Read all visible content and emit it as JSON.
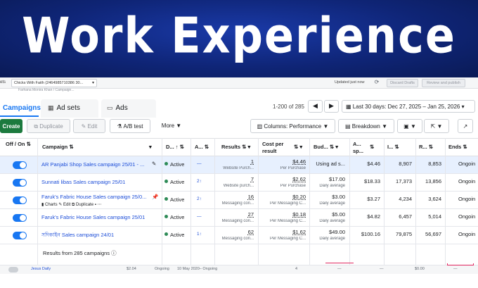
{
  "banner": {
    "title": "Work Experience"
  },
  "topbar": {
    "sets_label": "ets",
    "account": "Chicks With Faith (2464985710386 30...",
    "updated": "Updated just now",
    "discard_label": "Discard Drafts",
    "review_label": "Review and publish"
  },
  "breadcrumb": "Farhana Monira Khan / Campaign...",
  "tabs": {
    "campaigns": "Campaigns",
    "adsets": "Ad sets",
    "ads": "Ads"
  },
  "pager": {
    "range": "1-200 of 285",
    "prev": "◀",
    "next": "▶"
  },
  "date_range": "Last 30 days: Dec 27, 2025 – Jan 25, 2026",
  "toolbar": {
    "create": "Create",
    "duplicate": "Duplicate",
    "edit": "Edit",
    "ab_test": "A/B test",
    "more": "More",
    "columns": "Columns: Performance",
    "breakdown": "Breakdown"
  },
  "columns": {
    "offon": "Off / On",
    "campaign": "Campaign",
    "delivery": "D...",
    "attribution": "A...",
    "results": "Results",
    "cost": "Cost per result",
    "budget": "Bud...",
    "amount": "A... sp...",
    "impressions": "I...",
    "reach": "R...",
    "ends": "Ends"
  },
  "rows": [
    {
      "name": "AR Panjabi Shop Sales campaign 25/01 - ...",
      "delivery": "Active",
      "attr": "—",
      "results": "1",
      "results_sub": "Website Purch...",
      "cost": "$4.46",
      "cost_sub": "Per Purchase",
      "budget": "Using ad s...",
      "budget_sub": "",
      "spent": "$4.46",
      "impr": "8,907",
      "reach": "8,853",
      "ends": "Ongoin",
      "selected": true,
      "charts": "",
      "edit": "",
      "dup": ""
    },
    {
      "name": "Sunnati libas Sales campaign 25/01",
      "delivery": "Active",
      "attr": "2↑",
      "results": "7",
      "results_sub": "Website purch...",
      "cost": "$2.62",
      "cost_sub": "Per Purchase",
      "budget": "$17.00",
      "budget_sub": "Daily average",
      "spent": "$18.33",
      "impr": "17,373",
      "reach": "13,856",
      "ends": "Ongoin",
      "selected": false,
      "charts": "",
      "edit": "",
      "dup": ""
    },
    {
      "name": "Faruk's Fabric House Sales campaign 25/0...",
      "delivery": "Active",
      "attr": "2↑",
      "results": "16",
      "results_sub": "Messaging con...",
      "cost": "$0.20",
      "cost_sub": "Per Messaging C...",
      "budget": "$3.00",
      "budget_sub": "Daily average",
      "spent": "$3.27",
      "impr": "4,234",
      "reach": "3,624",
      "ends": "Ongoin",
      "selected": false,
      "charts": "Charts",
      "edit": "Edit",
      "dup": "Duplicate"
    },
    {
      "name": "Faruk's Fabric House Sales campaign 25/01",
      "delivery": "Active",
      "attr": "—",
      "results": "27",
      "results_sub": "Messaging con...",
      "cost": "$0.18",
      "cost_sub": "Per Messaging C...",
      "budget": "$5.00",
      "budget_sub": "Daily average",
      "spent": "$4.82",
      "impr": "6,457",
      "reach": "5,014",
      "ends": "Ongoin",
      "selected": false,
      "charts": "",
      "edit": "",
      "dup": ""
    },
    {
      "name": "সদিকাইন Sales campaign 24/01",
      "delivery": "Active",
      "attr": "1↑",
      "results": "62",
      "results_sub": "Messaging con...",
      "cost": "$1.62",
      "cost_sub": "Per Messaging C...",
      "budget": "$49.00",
      "budget_sub": "Daily average",
      "spent": "$100.16",
      "impr": "79,875",
      "reach": "56,697",
      "ends": "Ongoin",
      "selected": false,
      "charts": "",
      "edit": "",
      "dup": ""
    }
  ],
  "footer": {
    "results_from": "Results from 285 campaigns"
  },
  "bottom_row": {
    "name": "Jesus Daily",
    "spent": "$2.04",
    "status": "Ongoing",
    "date": "10 May 2020– Ongoing",
    "num": "4",
    "dash1": "—",
    "dash2": "—",
    "dash3": "—",
    "amount": "$0.00"
  }
}
